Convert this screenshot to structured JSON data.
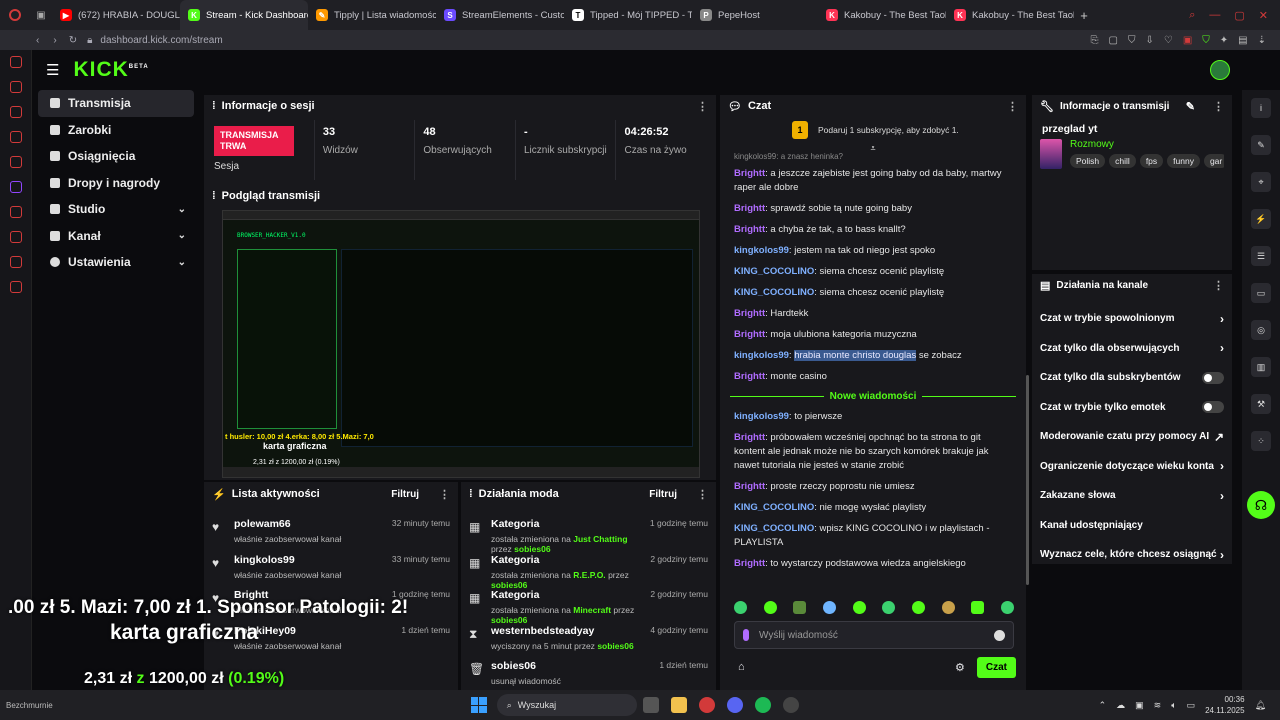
{
  "browser": {
    "tabs": [
      {
        "label": "(672) HRABIA - DOUGLAS",
        "color": "#ff0000",
        "glyph": "▶"
      },
      {
        "label": "Stream - Kick Dashboard",
        "color": "#53fc18",
        "glyph": "K"
      },
      {
        "label": "Tipply | Lista wiadomości",
        "color": "#ff9900",
        "glyph": "✎"
      },
      {
        "label": "StreamElements - Custo",
        "color": "#6b4bff",
        "glyph": "S"
      },
      {
        "label": "Tipped - Mój TIPPED - Ti",
        "color": "#ffffff",
        "glyph": "T"
      },
      {
        "label": "PepeHost",
        "color": "#888888",
        "glyph": "P"
      },
      {
        "label": "Kakobuy - The Best Taob",
        "color": "#ff3355",
        "glyph": "K"
      },
      {
        "label": "Kakobuy - The Best Taob",
        "color": "#ff3355",
        "glyph": "K"
      }
    ],
    "url": "dashboard.kick.com/stream"
  },
  "nav": {
    "items": [
      {
        "label": "Transmisja",
        "active": true
      },
      {
        "label": "Zarobki"
      },
      {
        "label": "Osiągnięcia"
      },
      {
        "label": "Dropy i nagrody"
      },
      {
        "label": "Studio",
        "chev": "⌄"
      },
      {
        "label": "Kanał",
        "chev": "⌄"
      },
      {
        "label": "Ustawienia",
        "chev": "⌄"
      }
    ]
  },
  "session": {
    "title": "Informacje o sesji",
    "badge": "TRANSMISJA TRWA",
    "badge_label": "Sesja",
    "stats": [
      {
        "value": "33",
        "label": "Widzów"
      },
      {
        "value": "48",
        "label": "Obserwujących"
      },
      {
        "value": "-",
        "label": "Licznik subskrypcji"
      },
      {
        "value": "04:26:52",
        "label": "Czas na żywo"
      }
    ]
  },
  "preview": {
    "title": "Podgląd transmisji",
    "app_title": "BROWSER_HACKER_V1.0",
    "ticker": "t husler: 10,00 zł 4.erka: 8,00 zł 5.Mazi: 7,0",
    "caption": "karta graficzna",
    "goal": "2,31 zł z 1200,00 zł (0.19%)"
  },
  "activity": {
    "title": "Lista aktywności",
    "filter": "Filtruj",
    "items": [
      {
        "name": "polewam66",
        "desc": "właśnie zaobserwował kanał",
        "time": "32 minuty temu"
      },
      {
        "name": "kingkolos99",
        "desc": "właśnie zaobserwował kanał",
        "time": "33 minuty temu"
      },
      {
        "name": "Brightt",
        "desc": "właśnie zaobserwował kanał",
        "time": "1 godzinę temu"
      },
      {
        "name": "PolskiHey09",
        "desc": "właśnie zaobserwował kanał",
        "time": "1 dzień temu"
      }
    ]
  },
  "mod": {
    "title": "Działania moda",
    "filter": "Filtruj",
    "items": [
      {
        "name": "Kategoria",
        "pre": "została zmieniona na",
        "hl": "Just Chatting",
        "mid": "przez",
        "by": "sobies06",
        "time": "1 godzinę temu"
      },
      {
        "name": "Kategoria",
        "pre": "została zmieniona na",
        "hl": "R.E.P.O.",
        "mid": "przez",
        "by": "sobies06",
        "time": "2 godziny temu"
      },
      {
        "name": "Kategoria",
        "pre": "została zmieniona na",
        "hl": "Minecraft",
        "mid": "przez",
        "by": "sobies06",
        "time": "2 godziny temu"
      },
      {
        "name": "westernbedsteadyay",
        "pre": "wyciszony na 5 minut przez",
        "hl": "",
        "mid": "",
        "by": "sobies06",
        "time": "4 godziny temu"
      },
      {
        "name": "sobies06",
        "pre": "usunął wiadomość",
        "hl": "",
        "mid": "",
        "by": "",
        "time": "1 dzień temu"
      }
    ]
  },
  "chat": {
    "title": "Czat",
    "banner": "Podaruj 1 subskrypcję, aby zdobyć 1.",
    "partial": "kingkolos99: a znasz heninka?",
    "new_label": "Nowe wiadomości",
    "placeholder": "Wyślij wiadomość",
    "send": "Czat",
    "messages": [
      {
        "user": "Brightt",
        "cls": "p",
        "text": "a jeszcze zajebiste jest going baby od da baby, martwy raper ale dobre"
      },
      {
        "user": "Brightt",
        "cls": "p",
        "text": "sprawdź sobie tą nute going baby"
      },
      {
        "user": "Brightt",
        "cls": "p",
        "text": "a chyba że tak, a to bass knallt?"
      },
      {
        "user": "kingkolos99",
        "cls": "c",
        "text": "jestem na tak od niego jest spoko"
      },
      {
        "user": "KING_COCOLINO",
        "cls": "c",
        "text": "siema chcesz ocenić playlistę"
      },
      {
        "user": "KING_COCOLINO",
        "cls": "c",
        "text": "siema chcesz ocenić playlistę"
      },
      {
        "user": "Brightt",
        "cls": "p",
        "text": "Hardtekk"
      },
      {
        "user": "Brightt",
        "cls": "p",
        "text": "moja ulubiona kategoria muzyczna"
      },
      {
        "user": "kingkolos99",
        "cls": "c",
        "text": "se zobacz",
        "hl": "hrabia monte christo douglas"
      },
      {
        "user": "Brightt",
        "cls": "p",
        "text": "monte casino"
      }
    ],
    "messages2": [
      {
        "user": "kingkolos99",
        "cls": "c",
        "text": "to pierwsze"
      },
      {
        "user": "Brightt",
        "cls": "p",
        "text": "próbowałem wcześniej opchnąć bo ta strona to git kontent ale jednak może nie bo szarych komórek brakuje jak nawet tutoriala nie jesteś w stanie zrobić"
      },
      {
        "user": "Brightt",
        "cls": "p",
        "text": "proste rzeczy poprostu nie umiesz"
      },
      {
        "user": "KING_COCOLINO",
        "cls": "c",
        "text": "nie mogę wysłać playlisty"
      },
      {
        "user": "KING_COCOLINO",
        "cls": "c",
        "text": "wpisz KING COCOLINO i w playlistach - PLAYLISTA"
      },
      {
        "user": "Brightt",
        "cls": "p",
        "text": "to wystarczy podstawowa wiedza angielskiego"
      }
    ]
  },
  "info": {
    "title": "Informacje o transmisji",
    "stream_title": "przeglad yt",
    "category": "Rozmowy",
    "tags": [
      "Polish",
      "chill",
      "fps",
      "funny",
      "gar"
    ]
  },
  "actions": {
    "title": "Działania na kanale",
    "items": [
      {
        "label": "Czat w trybie spowolnionym",
        "ctl": "arrow"
      },
      {
        "label": "Czat tylko dla obserwujących",
        "ctl": "arrow"
      },
      {
        "label": "Czat tylko dla subskrybentów",
        "ctl": "toggle"
      },
      {
        "label": "Czat w trybie tylko emotek",
        "ctl": "toggle"
      },
      {
        "label": "Moderowanie czatu przy pomocy AI",
        "ctl": "ext"
      },
      {
        "label": "Ograniczenie dotyczące wieku konta",
        "ctl": "arrow"
      },
      {
        "label": "Zakazane słowa",
        "ctl": "arrow"
      },
      {
        "label": "Kanał udostępniający",
        "ctl": "none"
      },
      {
        "label": "Wyznacz cele, które chcesz osiągnąć",
        "ctl": "arrow"
      }
    ]
  },
  "overlay": {
    "ticker": ".00 zł 5. Mazi: 7,00 zł 1. Sponsor Patologii: 2!",
    "title": "karta graficzna",
    "goal_pre": "2,31 zł",
    "goal_z": "z",
    "goal_amt": "1200,00 zł",
    "goal_pct": "(0.19%)",
    "label": "Bezchmurnie"
  },
  "taskbar": {
    "search": "Wyszukaj",
    "time": "00:36",
    "date": "24.11.2025"
  }
}
